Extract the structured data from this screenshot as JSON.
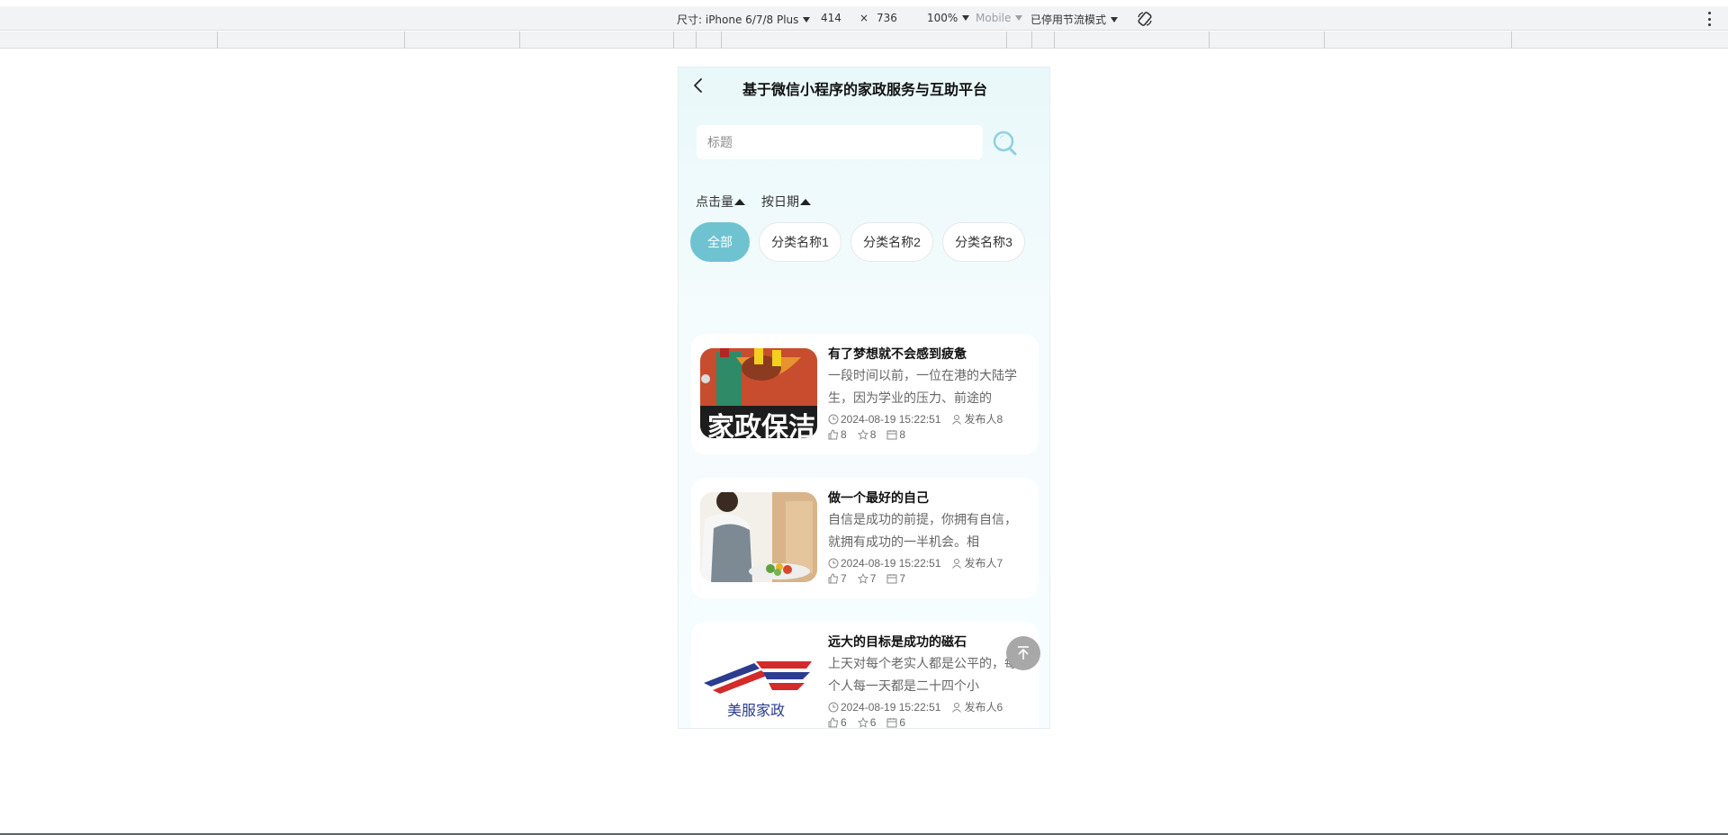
{
  "devtools": {
    "device_label": "尺寸: iPhone 6/7/8 Plus",
    "width": "414",
    "times": "×",
    "height": "736",
    "zoom": "100%",
    "mode": "Mobile",
    "throttle": "已停用节流模式"
  },
  "app": {
    "title": "基于微信小程序的家政服务与互助平台",
    "search_placeholder": "标题",
    "sort": [
      {
        "label": "点击量"
      },
      {
        "label": "按日期"
      }
    ],
    "categories": [
      "全部",
      "分类名称1",
      "分类名称2",
      "分类名称3"
    ],
    "articles": [
      {
        "title": "有了梦想就不会感到疲惫",
        "desc": "一段时间以前，一位在港的大陆学生，因为学业的压力、前途的",
        "time": "2024-08-19 15:22:51",
        "author": "发布人8",
        "likes": "8",
        "favorites": "8",
        "views": "8",
        "image_text": "家政保洁"
      },
      {
        "title": "做一个最好的自己",
        "desc": "自信是成功的前提，你拥有自信，就拥有成功的一半机会。相",
        "time": "2024-08-19 15:22:51",
        "author": "发布人7",
        "likes": "7",
        "favorites": "7",
        "views": "7"
      },
      {
        "title": "远大的目标是成功的磁石",
        "desc": "上天对每个老实人都是公平的，每个人每一天都是二十四个小",
        "time": "2024-08-19 15:22:51",
        "author": "发布人6",
        "likes": "6",
        "favorites": "6",
        "views": "6",
        "image_text": "美服家政"
      }
    ]
  },
  "colors": {
    "accent": "#6fc3d1",
    "background": "#eef9fb"
  }
}
